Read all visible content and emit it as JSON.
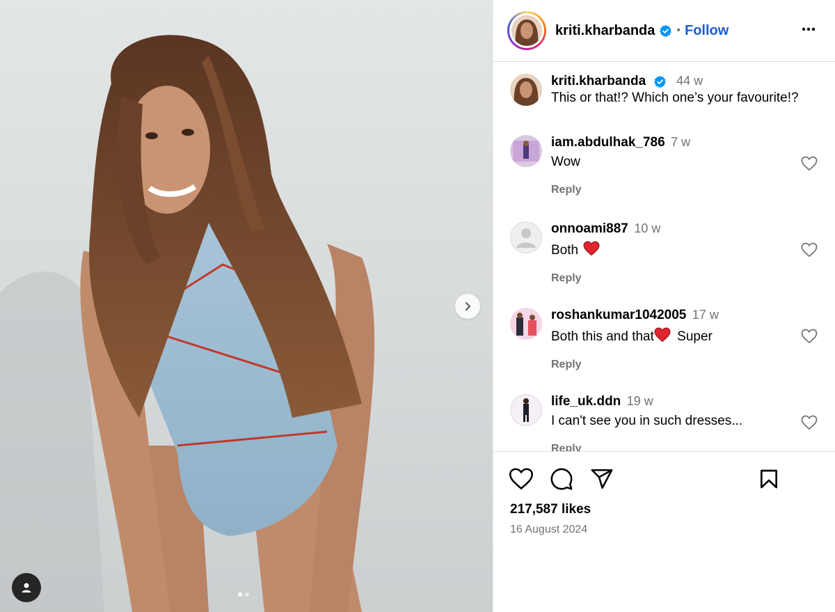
{
  "post": {
    "author": "kriti.kharbanda",
    "verified": true,
    "follow_label": "Follow",
    "separator": "•",
    "more_icon": "more-horizontal-icon",
    "caption": {
      "user": "kriti.kharbanda",
      "time": "44 w",
      "text": "This or that!? Which one’s your favourite!?"
    },
    "likes": "217,587 likes",
    "date": "16 August 2024"
  },
  "comments": [
    {
      "user": "iam.abdulhak_786",
      "time": "7 w",
      "text": "Wow",
      "reply_label": "Reply"
    },
    {
      "user": "onnoami887",
      "time": "10 w",
      "text": "Both",
      "emoji": "red-heart",
      "reply_label": "Reply"
    },
    {
      "user": "roshankumar1042005",
      "time": "17 w",
      "text": "Both this and that",
      "text_after": "Super",
      "emoji": "red-heart",
      "reply_label": "Reply"
    },
    {
      "user": "life_uk.ddn",
      "time": "19 w",
      "text": "I can't see you in such dresses...",
      "reply_label": "Reply"
    }
  ],
  "media": {
    "carousel_dots": 2,
    "active_dot": 1
  },
  "colors": {
    "follow": "#1a5bd8",
    "verified": "#0095f6",
    "muted": "#737373",
    "divider": "#dbdbdb",
    "heart": "#e0242f"
  }
}
